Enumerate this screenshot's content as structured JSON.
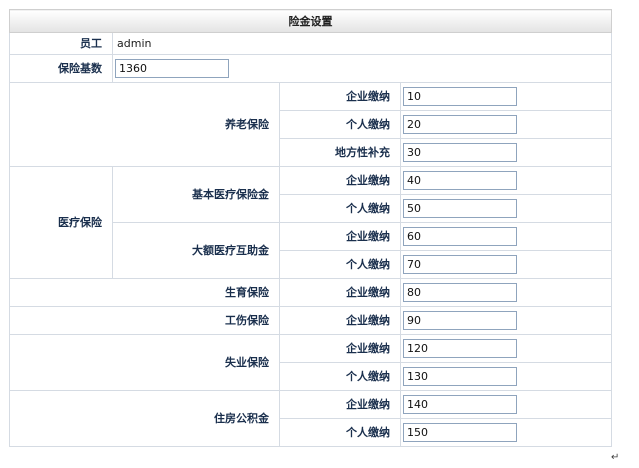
{
  "header": {
    "title": "险金设置"
  },
  "employee": {
    "label": "员工",
    "value": "admin"
  },
  "base": {
    "label": "保险基数",
    "value": "1360"
  },
  "labels": {
    "company": "企业缴纳",
    "personal": "个人缴纳",
    "local_supplement": "地方性补充"
  },
  "pension": {
    "name": "养老保险",
    "company": "10",
    "personal": "20",
    "local_supplement": "30"
  },
  "medical": {
    "name": "医疗保险",
    "basic": {
      "name": "基本医疗保险金",
      "company": "40",
      "personal": "50"
    },
    "major": {
      "name": "大额医疗互助金",
      "company": "60",
      "personal": "70"
    }
  },
  "maternity": {
    "name": "生育保险",
    "company": "80"
  },
  "injury": {
    "name": "工伤保险",
    "company": "90"
  },
  "unemployment": {
    "name": "失业保险",
    "company": "120",
    "personal": "130"
  },
  "housing": {
    "name": "住房公积金",
    "company": "140",
    "personal": "150"
  },
  "mark": "↵"
}
